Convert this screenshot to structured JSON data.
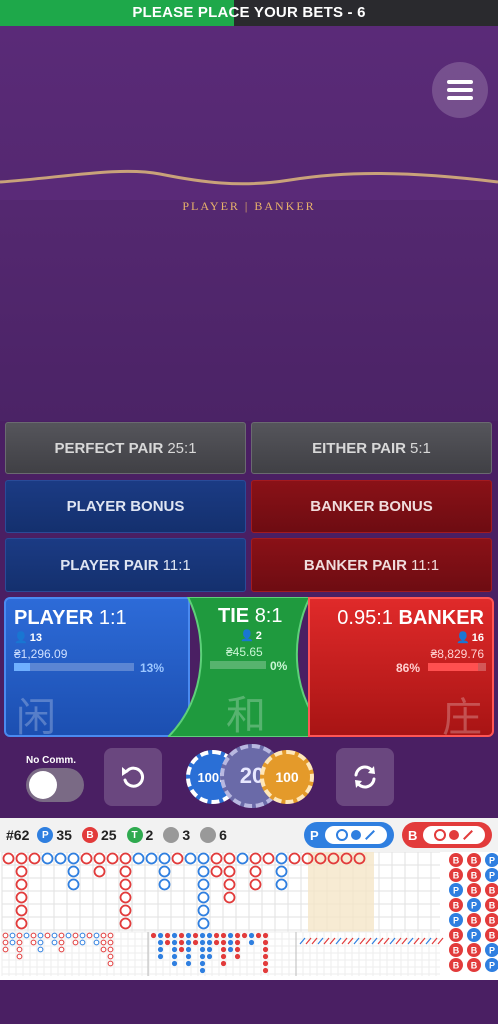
{
  "timer": {
    "label": "PLEASE PLACE YOUR BETS - 6",
    "progress": 0.47,
    "fill_color": "#1ea84a"
  },
  "header": {
    "menu_icon": "hamburger-icon",
    "table_label": "PLAYER | BANKER"
  },
  "side_bets": [
    {
      "label": "PERFECT PAIR",
      "odds": "25:1",
      "style": "gray"
    },
    {
      "label": "EITHER PAIR",
      "odds": "5:1",
      "style": "gray"
    },
    {
      "label": "PLAYER BONUS",
      "odds": "",
      "style": "blue"
    },
    {
      "label": "BANKER BONUS",
      "odds": "",
      "style": "red"
    },
    {
      "label": "PLAYER PAIR",
      "odds": "11:1",
      "style": "blue"
    },
    {
      "label": "BANKER PAIR",
      "odds": "11:1",
      "style": "red"
    }
  ],
  "main_bets": {
    "player": {
      "label": "PLAYER",
      "ratio": "1:1",
      "players": "13",
      "amount": "₴1,296.09",
      "percent": "13%",
      "percent_value": 0.13,
      "glyph": "闲",
      "color": "#2d6bd8"
    },
    "tie": {
      "label": "TIE",
      "ratio": "8:1",
      "players": "2",
      "amount": "₴45.65",
      "percent": "0%",
      "percent_value": 0.0,
      "glyph": "和",
      "color": "#1f9a3e"
    },
    "banker": {
      "label": "BANKER",
      "ratio": "0.95:1",
      "players": "16",
      "amount": "₴8,829.76",
      "percent": "86%",
      "percent_value": 0.86,
      "glyph": "庄",
      "color": "#d42020"
    }
  },
  "controls": {
    "no_comm_label": "No Comm.",
    "no_comm_on": false,
    "undo_icon": "undo-icon",
    "repeat_icon": "repeat-icon",
    "chips": [
      "100K",
      "20",
      "100"
    ]
  },
  "roadmap": {
    "round": "#62",
    "player_count": "35",
    "banker_count": "25",
    "tie_count": "2",
    "player_pair_count": "3",
    "banker_pair_count": "6",
    "player_letter": "P",
    "banker_letter": "B",
    "tie_letter": "T",
    "colors": {
      "player": "#2f7fe0",
      "banker": "#e23b3b",
      "tie": "#2faa4f"
    }
  }
}
